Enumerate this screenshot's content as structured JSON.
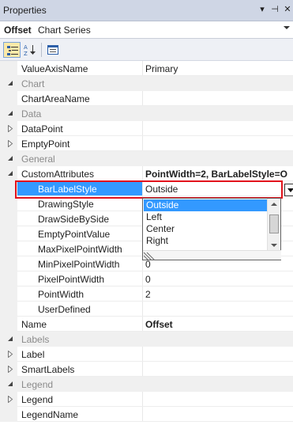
{
  "window": {
    "title": "Properties",
    "buttons": [
      "▾",
      "⊣",
      "✕"
    ]
  },
  "object_selector": {
    "name": "Offset",
    "type": "Chart Series"
  },
  "toolbar": {
    "buttons": [
      {
        "name": "categorized-button",
        "icon": "categorized-icon",
        "active": true
      },
      {
        "name": "alphabetical-button",
        "icon": "alphabetical-icon",
        "active": false
      },
      {
        "name": "property-pages-button",
        "icon": "property-pages-icon",
        "active": false
      }
    ]
  },
  "grid": {
    "rows": [
      {
        "kind": "prop",
        "name": "ValueAxisName",
        "value": "Primary",
        "indent": 0
      },
      {
        "kind": "cat",
        "name": "Chart",
        "expander": "expanded"
      },
      {
        "kind": "prop",
        "name": "ChartAreaName",
        "value": "",
        "indent": 0
      },
      {
        "kind": "cat",
        "name": "Data",
        "expander": "expanded"
      },
      {
        "kind": "prop",
        "name": "DataPoint",
        "value": "",
        "indent": 0,
        "expander": "collapsed"
      },
      {
        "kind": "prop",
        "name": "EmptyPoint",
        "value": "",
        "indent": 0,
        "expander": "collapsed"
      },
      {
        "kind": "cat",
        "name": "General",
        "expander": "expanded"
      },
      {
        "kind": "prop",
        "name": "CustomAttributes",
        "value": "PointWidth=2, BarLabelStyle=O",
        "value_bold": true,
        "indent": 0,
        "expander": "expanded"
      },
      {
        "kind": "prop",
        "name": "BarLabelStyle",
        "value": "Outside",
        "indent": 1,
        "selected": true
      },
      {
        "kind": "prop",
        "name": "DrawingStyle",
        "value": "",
        "indent": 1
      },
      {
        "kind": "prop",
        "name": "DrawSideBySide",
        "value": "",
        "indent": 1
      },
      {
        "kind": "prop",
        "name": "EmptyPointValue",
        "value": "",
        "indent": 1
      },
      {
        "kind": "prop",
        "name": "MaxPixelPointWidth",
        "value": "",
        "indent": 1
      },
      {
        "kind": "prop",
        "name": "MinPixelPointWidth",
        "value": "0",
        "indent": 1
      },
      {
        "kind": "prop",
        "name": "PixelPointWidth",
        "value": "0",
        "indent": 1
      },
      {
        "kind": "prop",
        "name": "PointWidth",
        "value": "2",
        "indent": 1
      },
      {
        "kind": "prop",
        "name": "UserDefined",
        "value": "",
        "indent": 1
      },
      {
        "kind": "prop",
        "name": "Name",
        "value": "Offset",
        "value_bold": true,
        "indent": 0
      },
      {
        "kind": "cat",
        "name": "Labels",
        "expander": "expanded"
      },
      {
        "kind": "prop",
        "name": "Label",
        "value": "",
        "indent": 0,
        "expander": "collapsed"
      },
      {
        "kind": "prop",
        "name": "SmartLabels",
        "value": "",
        "indent": 0,
        "expander": "collapsed"
      },
      {
        "kind": "cat",
        "name": "Legend",
        "expander": "expanded"
      },
      {
        "kind": "prop",
        "name": "Legend",
        "value": "",
        "indent": 0,
        "expander": "collapsed"
      },
      {
        "kind": "prop",
        "name": "LegendName",
        "value": "",
        "indent": 0
      }
    ]
  },
  "dropdown": {
    "options": [
      "Outside",
      "Left",
      "Center",
      "Right"
    ],
    "selected": "Outside"
  },
  "colors": {
    "selection": "#3399ff",
    "highlight_border": "#e2131c",
    "category_text": "#8b8b8b",
    "gutter": "#f0f0f0"
  }
}
